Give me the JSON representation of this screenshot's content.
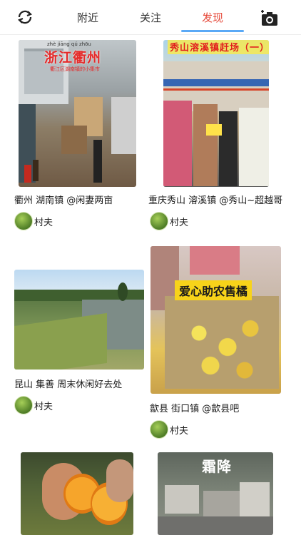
{
  "tabs": {
    "nearby": "附近",
    "follow": "关注",
    "discover": "发现"
  },
  "accent_color": "#e64b3c",
  "icons": {
    "left": "refresh-icon",
    "right": "camera-add-icon"
  },
  "cards": [
    {
      "image_overlay": "浙江衢州",
      "image_pinyin": "zhè jiāng qú zhōu",
      "image_subtitle": "衢江区湖南镇的小集市",
      "caption": "衢州 湖南镇 @闲妻两亩",
      "author": "村夫"
    },
    {
      "image_overlay": "秀山溶溪镇赶场（一）",
      "caption": "重庆秀山 溶溪镇 @秀山~超越哥",
      "author": "村夫"
    },
    {
      "caption": "昆山 集善 周末休闲好去处",
      "author": "村夫"
    },
    {
      "image_overlay": "爱心助农售橘",
      "caption": "歙县 街口镇 @歙县吧",
      "author": "村夫"
    },
    {
      "caption": "",
      "author": ""
    },
    {
      "image_overlay": "霜降",
      "caption": "",
      "author": ""
    }
  ]
}
